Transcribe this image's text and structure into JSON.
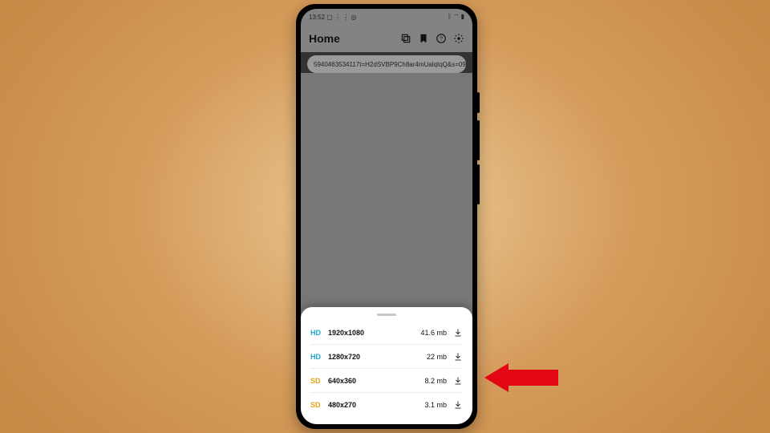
{
  "status": {
    "time": "13:52",
    "left_icons": [
      "linkedin-icon",
      "dots-icon",
      "dots-icon",
      "motorola-icon"
    ],
    "right_icons": [
      "bluetooth-icon",
      "wifi-icon",
      "signal-icon",
      "battery-icon"
    ]
  },
  "appbar": {
    "title": "Home",
    "actions": [
      {
        "name": "library-icon"
      },
      {
        "name": "bookmark-icon"
      },
      {
        "name": "help-icon"
      },
      {
        "name": "settings-icon"
      }
    ]
  },
  "url": "5940463534117t=H2dSVBP9Ch8ar4mUalqtqQ&s=09",
  "sheet": {
    "rows": [
      {
        "badge": "HD",
        "badge_class": "hd",
        "res": "1920x1080",
        "size": "41.6 mb"
      },
      {
        "badge": "HD",
        "badge_class": "hd",
        "res": "1280x720",
        "size": "22 mb"
      },
      {
        "badge": "SD",
        "badge_class": "sd",
        "res": "640x360",
        "size": "8.2 mb"
      },
      {
        "badge": "SD",
        "badge_class": "sd",
        "res": "480x270",
        "size": "3.1 mb"
      }
    ]
  },
  "arrow_color": "#e30613"
}
